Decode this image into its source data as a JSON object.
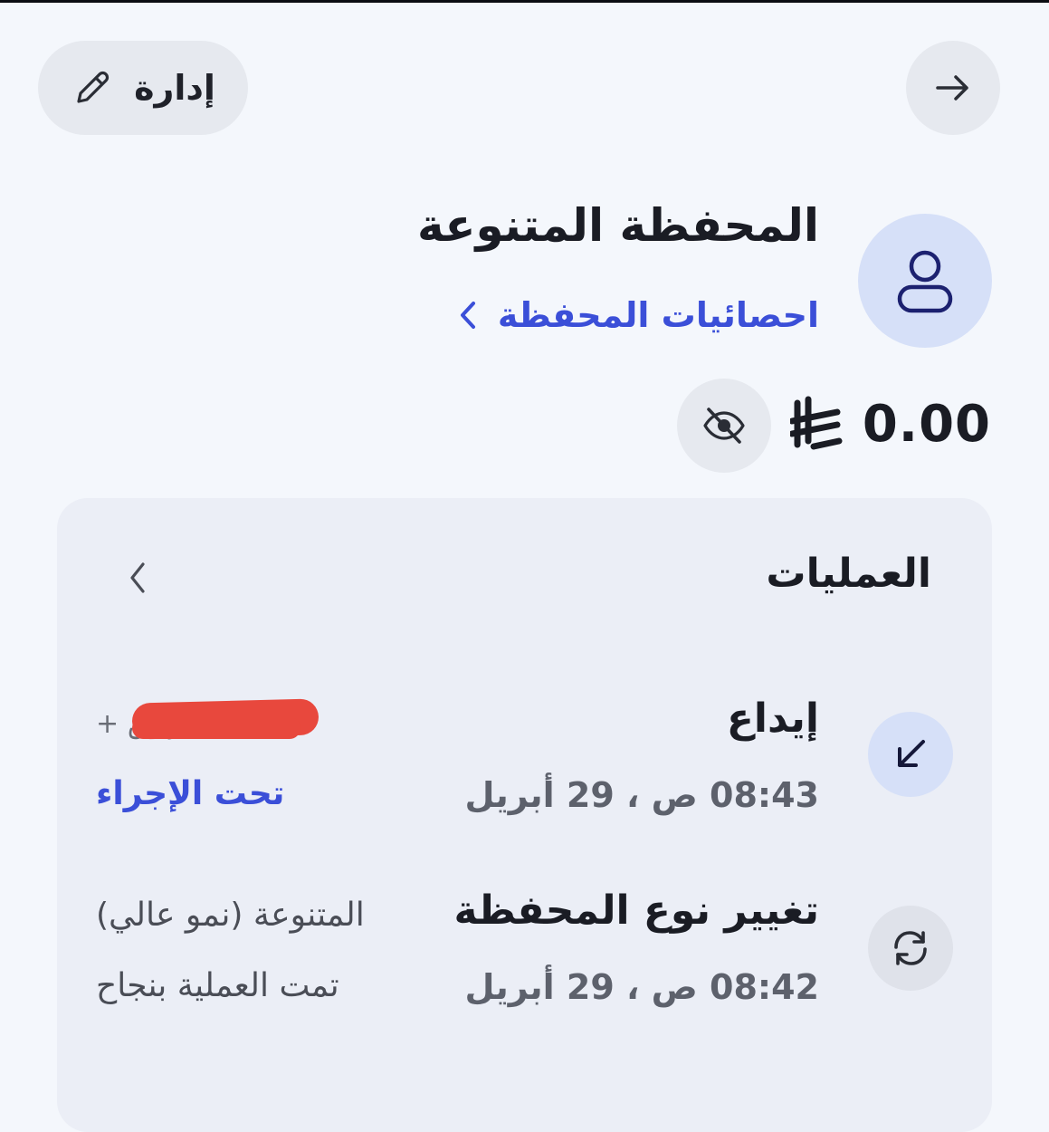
{
  "header": {
    "manage_label": "إدارة",
    "back_icon": "arrow-right-icon",
    "edit_icon": "pencil-icon"
  },
  "portfolio": {
    "title": "المحفظة المتنوعة",
    "stats_link": "احصائيات المحفظة",
    "avatar_icon": "user-icon"
  },
  "balance": {
    "value": "0.00",
    "currency_icon": "saudi-riyal-icon",
    "visibility_icon": "eye-off-icon"
  },
  "operations": {
    "title": "العمليات",
    "items": [
      {
        "icon": "arrow-down-left-icon",
        "title": "إيداع",
        "time": "08:43 ص ، 29 أبريل",
        "status": "تحت الإجراء",
        "amount": "+ ر.س"
      },
      {
        "icon": "refresh-icon",
        "title": "تغيير نوع المحفظة",
        "time": "08:42 ص ، 29 أبريل",
        "detail": "المتنوعة (نمو عالي)",
        "status": "تمت العملية بنجاح"
      }
    ]
  },
  "colors": {
    "accent": "#3b4fd8",
    "background": "#f4f7fc",
    "card": "#ebeef6",
    "redaction": "#e8483d"
  }
}
